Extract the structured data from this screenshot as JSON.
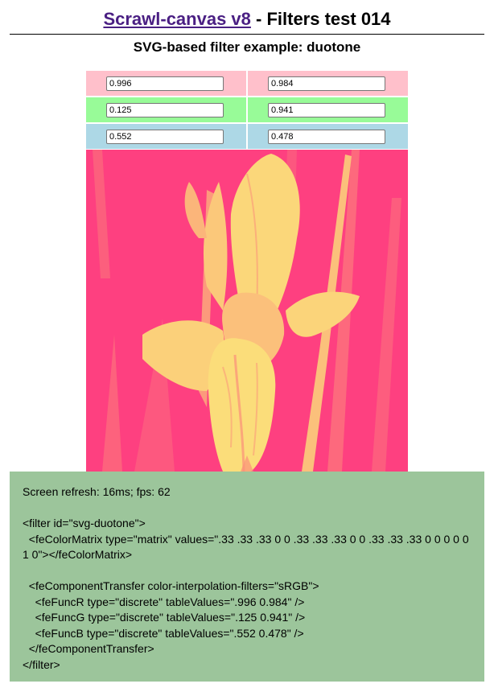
{
  "header": {
    "title_link": "Scrawl-canvas v8",
    "title_rest": " - Filters test 014",
    "subtitle": "SVG-based filter example: duotone"
  },
  "controls": {
    "rows": [
      {
        "color": "#ffc0cb",
        "left_value": "0.996",
        "right_value": "0.984"
      },
      {
        "color": "#98fb98",
        "left_value": "0.125",
        "right_value": "0.941"
      },
      {
        "color": "#add8e6",
        "left_value": "0.552",
        "right_value": "0.478"
      }
    ]
  },
  "canvas": {
    "shadow_color": "#fe4080",
    "highlight_color": "#fbf07a"
  },
  "report": {
    "refresh": "Screen refresh: 16ms; fps: 62",
    "markup": "<filter id=\"svg-duotone\">\n  <feColorMatrix type=\"matrix\" values=\".33 .33 .33 0 0 .33 .33 .33 0 0 .33 .33 .33 0 0 0 0 0 1 0\"></feColorMatrix>\n\n  <feComponentTransfer color-interpolation-filters=\"sRGB\">\n    <feFuncR type=\"discrete\" tableValues=\".996 0.984\" />\n    <feFuncG type=\"discrete\" tableValues=\".125 0.941\" />\n    <feFuncB type=\"discrete\" tableValues=\".552 0.478\" />\n  </feComponentTransfer>\n</filter>"
  }
}
